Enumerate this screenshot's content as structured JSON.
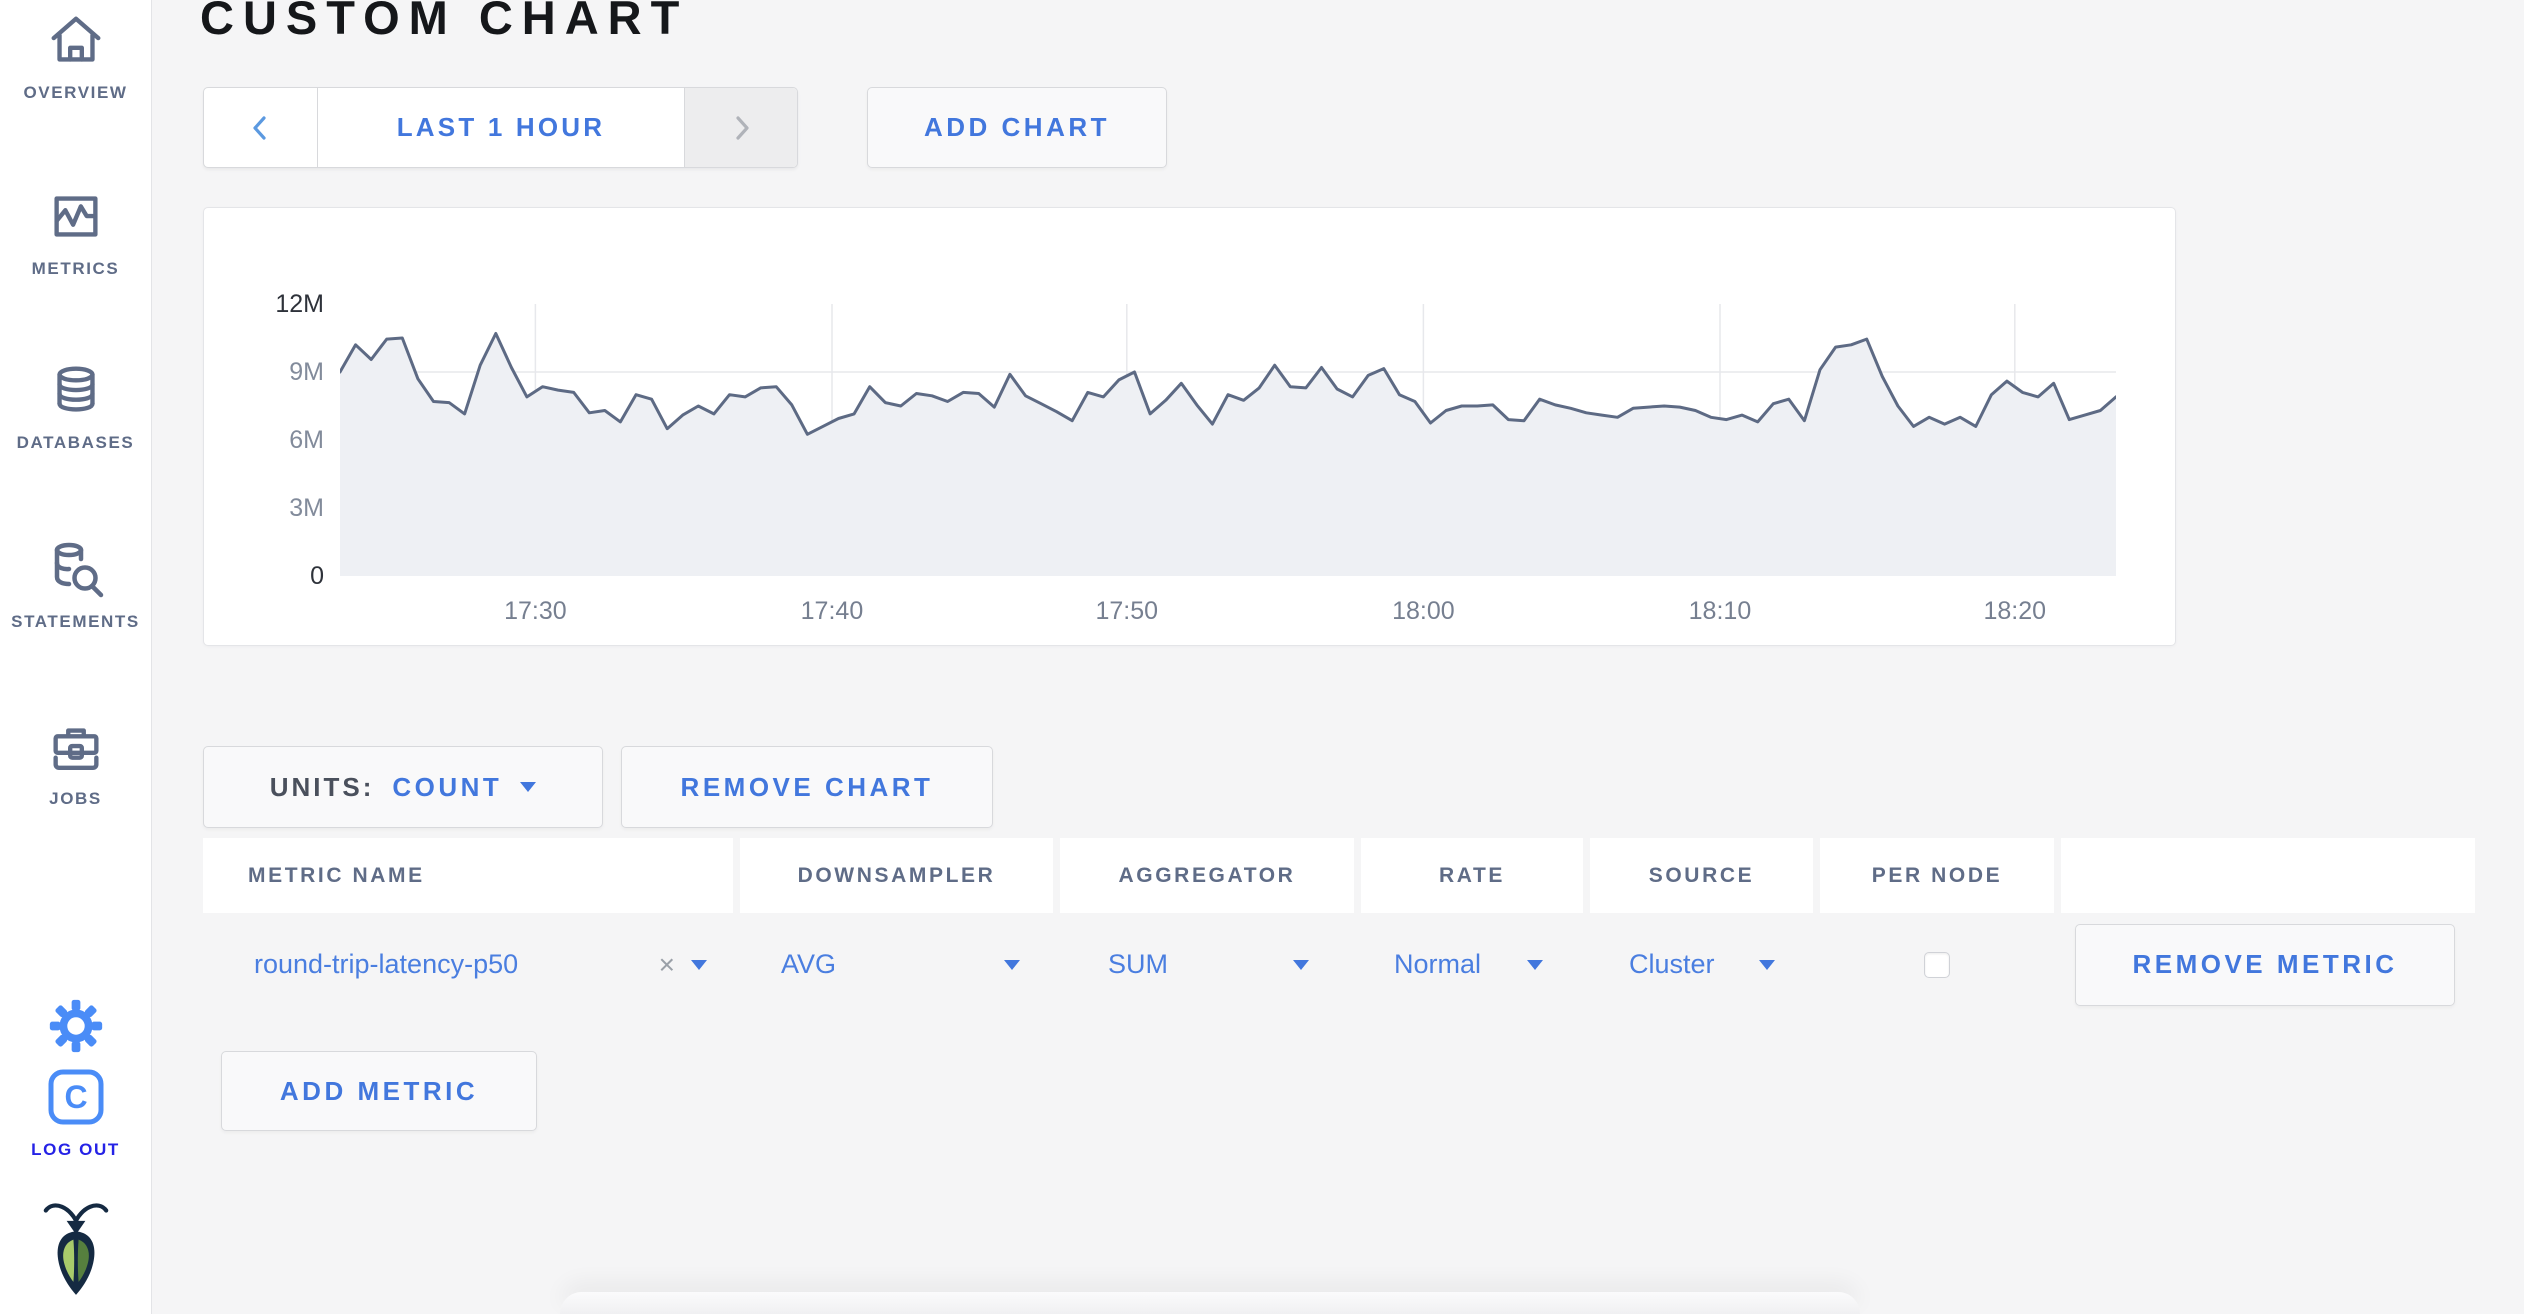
{
  "header": {
    "title": "CUSTOM CHART"
  },
  "sidebar": {
    "items": [
      {
        "label": "OVERVIEW",
        "icon": "home-icon"
      },
      {
        "label": "METRICS",
        "icon": "metrics-icon"
      },
      {
        "label": "DATABASES",
        "icon": "databases-icon"
      },
      {
        "label": "STATEMENTS",
        "icon": "statements-icon"
      },
      {
        "label": "JOBS",
        "icon": "jobs-icon"
      }
    ],
    "logout_label": "LOG OUT",
    "logout_icon_letter": "C"
  },
  "toolbar": {
    "time_range_label": "LAST 1 HOUR",
    "add_chart_label": "ADD CHART"
  },
  "chart_controls": {
    "units_label": "UNITS:",
    "units_value": "COUNT",
    "remove_chart_label": "REMOVE CHART",
    "remove_metric_label": "REMOVE METRIC",
    "add_metric_label": "ADD METRIC",
    "clear_glyph": "×"
  },
  "metric_table": {
    "headers": [
      "METRIC NAME",
      "DOWNSAMPLER",
      "AGGREGATOR",
      "RATE",
      "SOURCE",
      "PER NODE"
    ],
    "rows": [
      {
        "metric_name": "round-trip-latency-p50",
        "downsampler": "AVG",
        "aggregator": "SUM",
        "rate": "Normal",
        "source": "Cluster",
        "per_node_checked": false
      }
    ]
  },
  "chart_data": {
    "type": "area",
    "title": "",
    "xlabel": "",
    "ylabel": "",
    "units": "count",
    "y_max_millions": 12,
    "h_gridlines_millions": [
      3,
      6,
      9
    ],
    "y_ticks": [
      {
        "label": "12M",
        "value": 12,
        "strong": true
      },
      {
        "label": "9M",
        "value": 9,
        "strong": false
      },
      {
        "label": "6M",
        "value": 6,
        "strong": false
      },
      {
        "label": "3M",
        "value": 3,
        "strong": false
      },
      {
        "label": "0",
        "value": 0,
        "strong": true
      }
    ],
    "x_ticks": [
      {
        "label": "17:30",
        "f": 0.11
      },
      {
        "label": "17:40",
        "f": 0.277
      },
      {
        "label": "17:50",
        "f": 0.443
      },
      {
        "label": "18:00",
        "f": 0.61
      },
      {
        "label": "18:10",
        "f": 0.777
      },
      {
        "label": "18:20",
        "f": 0.943
      }
    ],
    "series": [
      {
        "name": "round-trip-latency-p50",
        "values_unit": "millions",
        "values": [
          9.0,
          10.2,
          9.55,
          10.45,
          10.5,
          8.7,
          7.7,
          7.65,
          7.15,
          9.3,
          10.7,
          9.2,
          7.9,
          8.35,
          8.2,
          8.1,
          7.2,
          7.3,
          6.8,
          8.0,
          7.8,
          6.5,
          7.1,
          7.5,
          7.15,
          8.0,
          7.9,
          8.3,
          8.35,
          7.55,
          6.25,
          6.6,
          6.95,
          7.15,
          8.35,
          7.65,
          7.5,
          8.05,
          7.95,
          7.7,
          8.1,
          8.05,
          7.45,
          8.9,
          7.95,
          7.6,
          7.25,
          6.85,
          8.1,
          7.9,
          8.65,
          9.0,
          7.15,
          7.75,
          8.5,
          7.55,
          6.7,
          8.0,
          7.75,
          8.3,
          9.3,
          8.35,
          8.3,
          9.2,
          8.25,
          7.9,
          8.85,
          9.15,
          8.0,
          7.7,
          6.75,
          7.3,
          7.5,
          7.5,
          7.55,
          6.9,
          6.85,
          7.8,
          7.55,
          7.4,
          7.2,
          7.1,
          7.0,
          7.4,
          7.45,
          7.5,
          7.45,
          7.3,
          7.0,
          6.9,
          7.1,
          6.8,
          7.6,
          7.8,
          6.85,
          9.1,
          10.1,
          10.2,
          10.45,
          8.8,
          7.5,
          6.6,
          7.0,
          6.7,
          7.0,
          6.6,
          8.0,
          8.6,
          8.1,
          7.9,
          8.5,
          6.9,
          7.1,
          7.3,
          7.9
        ]
      }
    ],
    "legend": "off",
    "grid": "on"
  },
  "colors": {
    "accent_blue": "#4277dd",
    "slate": "#5F6C87",
    "logout_blue": "#2522e6",
    "bright_blue": "#4a8cf7",
    "line": "#5d6a84",
    "area_fill": "#eef0f4",
    "gridline": "#e7e8ec"
  }
}
